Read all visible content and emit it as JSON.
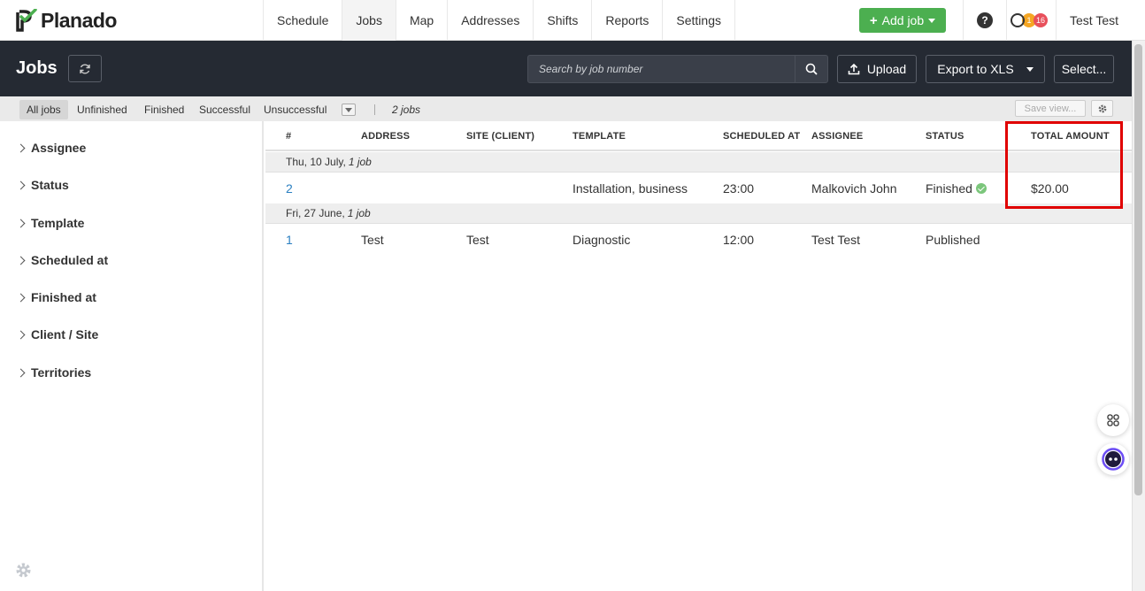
{
  "app": {
    "logo_text": "Planado"
  },
  "nav": {
    "items": [
      {
        "label": "Schedule",
        "active": false
      },
      {
        "label": "Jobs",
        "active": true
      },
      {
        "label": "Map",
        "active": false
      },
      {
        "label": "Addresses",
        "active": false
      },
      {
        "label": "Shifts",
        "active": false
      },
      {
        "label": "Reports",
        "active": false
      },
      {
        "label": "Settings",
        "active": false
      }
    ],
    "add_job_label": "Add job",
    "help_label": "?",
    "notification_counts": {
      "orange": "1",
      "red": "16"
    },
    "user_name": "Test Test"
  },
  "header": {
    "title": "Jobs",
    "search_placeholder": "Search by job number",
    "upload_label": "Upload",
    "export_label": "Export to XLS",
    "select_label": "Select..."
  },
  "filters": {
    "tabs": [
      "All jobs",
      "Unfinished",
      "Finished",
      "Successful",
      "Unsuccessful"
    ],
    "active_tab": "All jobs",
    "job_count": "2 jobs",
    "save_view_label": "Save view..."
  },
  "sidebar": {
    "items": [
      "Assignee",
      "Status",
      "Template",
      "Scheduled at",
      "Finished at",
      "Client / Site",
      "Territories"
    ]
  },
  "table": {
    "columns": [
      "#",
      "ADDRESS",
      "SITE (CLIENT)",
      "TEMPLATE",
      "SCHEDULED AT",
      "ASSIGNEE",
      "STATUS",
      "TOTAL AMOUNT"
    ],
    "groups": [
      {
        "date": "Thu, 10 July,",
        "count": "1 job",
        "rows": [
          {
            "num": "2",
            "address": "",
            "site": "",
            "template": "Installation, business",
            "scheduled": "23:00",
            "assignee": "Malkovich John",
            "status": "Finished",
            "total": "$20.00"
          }
        ]
      },
      {
        "date": "Fri, 27 June,",
        "count": "1 job",
        "rows": [
          {
            "num": "1",
            "address": "Test",
            "site": "Test",
            "template": "Diagnostic",
            "scheduled": "12:00",
            "assignee": "Test Test",
            "status": "Published",
            "total": ""
          }
        ]
      }
    ]
  },
  "colors": {
    "header_bg": "#252a33",
    "add_job_green": "#4caf50",
    "link_blue": "#2a7fc1",
    "highlight_red": "#e00000"
  }
}
